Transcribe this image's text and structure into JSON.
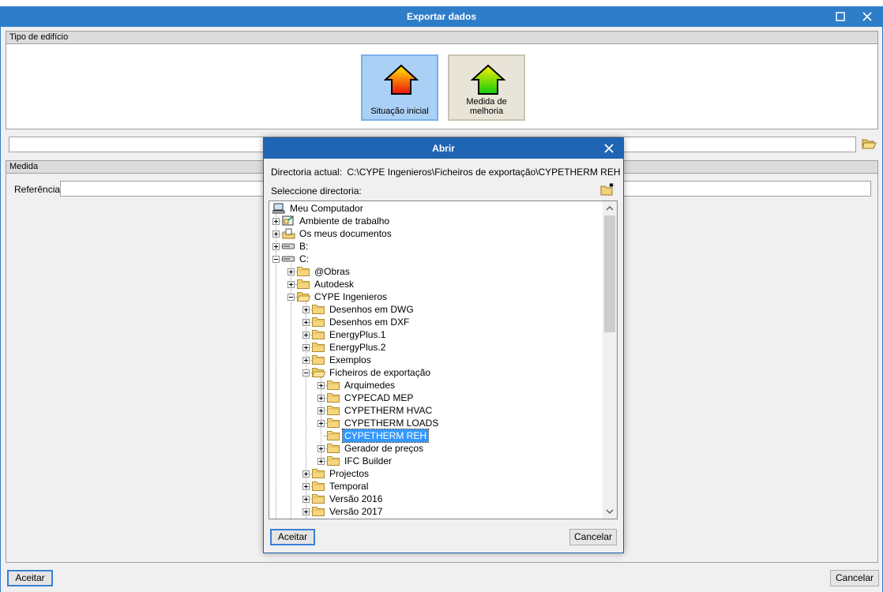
{
  "window": {
    "title": "Exportar dados",
    "group_building_type": "Tipo de edifício",
    "tiles": [
      {
        "label": "Situação inicial",
        "icon": "house-red-icon",
        "selected": true
      },
      {
        "label": "Medida de melhoria",
        "icon": "house-green-icon",
        "selected": false
      }
    ],
    "file_path_value": "",
    "group_measure": "Medida",
    "reference_label": "Referência",
    "reference_value": "",
    "accept_label": "Aceitar",
    "cancel_label": "Cancelar"
  },
  "dialog": {
    "title": "Abrir",
    "current_dir_label": "Directoria actual:",
    "current_dir_value": "C:\\CYPE Ingenieros\\Ficheiros de exportação\\CYPETHERM REH",
    "select_dir_label": "Seleccione directoria:",
    "tree": [
      {
        "label": "Meu Computador",
        "level": 0,
        "icon": "computer-icon",
        "expander": "none"
      },
      {
        "label": "Ambiente de trabalho",
        "level": 1,
        "icon": "desktop-icon",
        "expander": "plus"
      },
      {
        "label": "Os meus documentos",
        "level": 1,
        "icon": "documents-icon",
        "expander": "plus"
      },
      {
        "label": "B:",
        "level": 1,
        "icon": "drive-icon",
        "expander": "plus"
      },
      {
        "label": "C:",
        "level": 1,
        "icon": "drive-icon",
        "expander": "minus"
      },
      {
        "label": "@Obras",
        "level": 2,
        "icon": "folder-icon",
        "expander": "plus"
      },
      {
        "label": "Autodesk",
        "level": 2,
        "icon": "folder-icon",
        "expander": "plus"
      },
      {
        "label": "CYPE Ingenieros",
        "level": 2,
        "icon": "folder-open-icon",
        "expander": "minus"
      },
      {
        "label": "Desenhos em DWG",
        "level": 3,
        "icon": "folder-icon",
        "expander": "plus"
      },
      {
        "label": "Desenhos em DXF",
        "level": 3,
        "icon": "folder-icon",
        "expander": "plus"
      },
      {
        "label": "EnergyPlus.1",
        "level": 3,
        "icon": "folder-icon",
        "expander": "plus"
      },
      {
        "label": "EnergyPlus.2",
        "level": 3,
        "icon": "folder-icon",
        "expander": "plus"
      },
      {
        "label": "Exemplos",
        "level": 3,
        "icon": "folder-icon",
        "expander": "plus"
      },
      {
        "label": "Ficheiros de exportação",
        "level": 3,
        "icon": "folder-open-icon",
        "expander": "minus"
      },
      {
        "label": "Arquimedes",
        "level": 4,
        "icon": "folder-icon",
        "expander": "plus"
      },
      {
        "label": "CYPECAD MEP",
        "level": 4,
        "icon": "folder-icon",
        "expander": "plus"
      },
      {
        "label": "CYPETHERM HVAC",
        "level": 4,
        "icon": "folder-icon",
        "expander": "plus"
      },
      {
        "label": "CYPETHERM LOADS",
        "level": 4,
        "icon": "folder-icon",
        "expander": "plus"
      },
      {
        "label": "CYPETHERM REH",
        "level": 4,
        "icon": "folder-icon",
        "expander": "none",
        "selected": true
      },
      {
        "label": "Gerador de preços",
        "level": 4,
        "icon": "folder-icon",
        "expander": "plus"
      },
      {
        "label": "IFC Builder",
        "level": 4,
        "icon": "folder-icon",
        "expander": "plus"
      },
      {
        "label": "Projectos",
        "level": 3,
        "icon": "folder-icon",
        "expander": "plus"
      },
      {
        "label": "Temporal",
        "level": 3,
        "icon": "folder-icon",
        "expander": "plus"
      },
      {
        "label": "Versão 2016",
        "level": 3,
        "icon": "folder-icon",
        "expander": "plus"
      },
      {
        "label": "Versão 2017",
        "level": 3,
        "icon": "folder-icon",
        "expander": "plus"
      }
    ],
    "accept_label": "Aceitar",
    "cancel_label": "Cancelar"
  }
}
